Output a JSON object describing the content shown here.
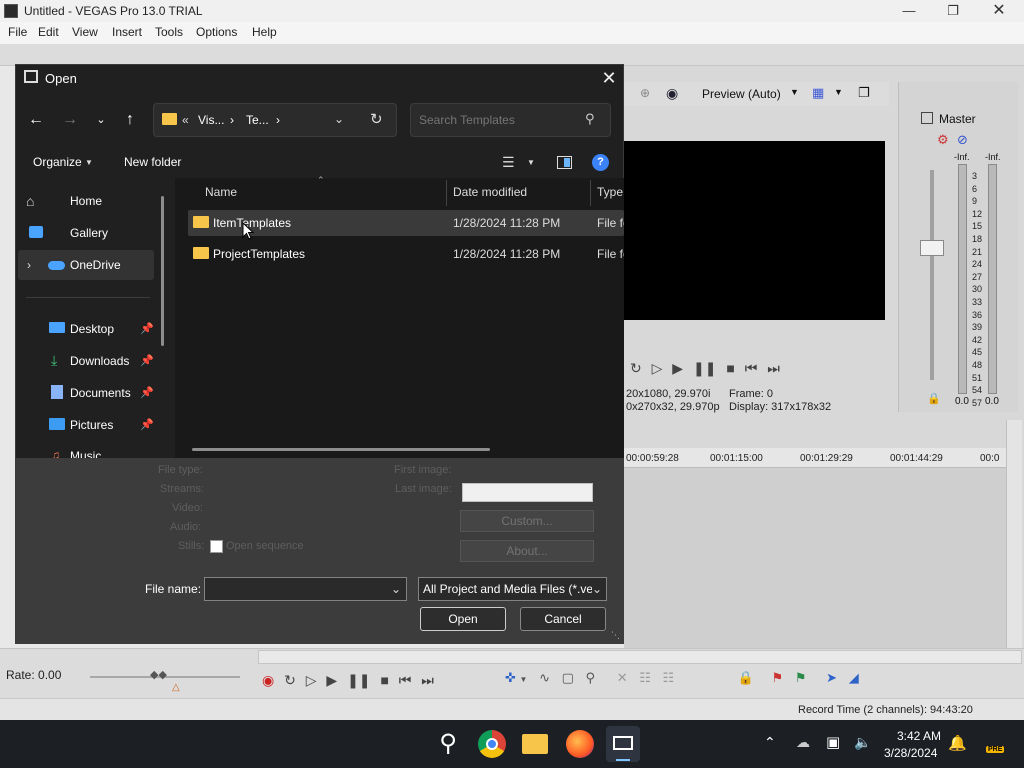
{
  "app": {
    "title": "Untitled - VEGAS Pro 13.0 TRIAL",
    "menu": [
      "File",
      "Edit",
      "View",
      "Insert",
      "Tools",
      "Options",
      "Help"
    ],
    "preview_mode": "Preview (Auto)",
    "master_label": "Master",
    "vu_top_left": "-Inf.",
    "vu_top_right": "-Inf.",
    "vu_bottom_left": "0.0",
    "vu_bottom_right": "0.0",
    "vu_scale": [
      "3",
      "6",
      "9",
      "12",
      "15",
      "18",
      "21",
      "24",
      "27",
      "30",
      "33",
      "36",
      "39",
      "42",
      "45",
      "48",
      "51",
      "54",
      "57"
    ],
    "preview_info_line1": "20x1080, 29.970i",
    "preview_info_line1b": "Frame:   0",
    "preview_info_line2": "0x270x32, 29.970p",
    "preview_info_line2b": "Display:   317x178x32",
    "ruler_ticks": [
      "00:00:59:28",
      "00:01:15:00",
      "00:01:29:29",
      "00:01:44:29",
      "00:0"
    ],
    "rate": "Rate: 0.00",
    "record_time": "Record Time (2 channels): 94:43:20"
  },
  "taskbar": {
    "time": "3:42 AM",
    "date": "3/28/2024",
    "badge": "PRE"
  },
  "dialog": {
    "title": "Open",
    "breadcrumb": [
      "«",
      "Vis...",
      "›",
      "Te...",
      "›"
    ],
    "search_placeholder": "Search Templates",
    "organize_label": "Organize",
    "new_folder_label": "New folder",
    "nav_items": [
      {
        "label": "Home",
        "icon": "home-icon"
      },
      {
        "label": "Gallery",
        "icon": "gallery-icon"
      },
      {
        "label": "OneDrive",
        "icon": "onedrive-icon"
      },
      {
        "label": "Desktop",
        "icon": "desktop-icon"
      },
      {
        "label": "Downloads",
        "icon": "downloads-icon"
      },
      {
        "label": "Documents",
        "icon": "documents-icon"
      },
      {
        "label": "Pictures",
        "icon": "pictures-icon"
      },
      {
        "label": "Music",
        "icon": "music-icon"
      }
    ],
    "columns": {
      "name": "Name",
      "date": "Date modified",
      "type": "Type"
    },
    "files": [
      {
        "name": "ItemTemplates",
        "date": "1/28/2024 11:28 PM",
        "type": "File fo"
      },
      {
        "name": "ProjectTemplates",
        "date": "1/28/2024 11:28 PM",
        "type": "File fo"
      }
    ],
    "ext": {
      "file_type": "File type:",
      "streams": "Streams:",
      "video": "Video:",
      "audio": "Audio:",
      "stills": "Stills:",
      "open_sequence": "Open sequence",
      "first_image": "First image:",
      "last_image": "Last image:",
      "custom_label": "Custom...",
      "about_label": "About..."
    },
    "file_name_label": "File name:",
    "file_name_value": "",
    "filter_value": "All Project and Media Files (*.ve",
    "open_label": "Open",
    "cancel_label": "Cancel"
  }
}
